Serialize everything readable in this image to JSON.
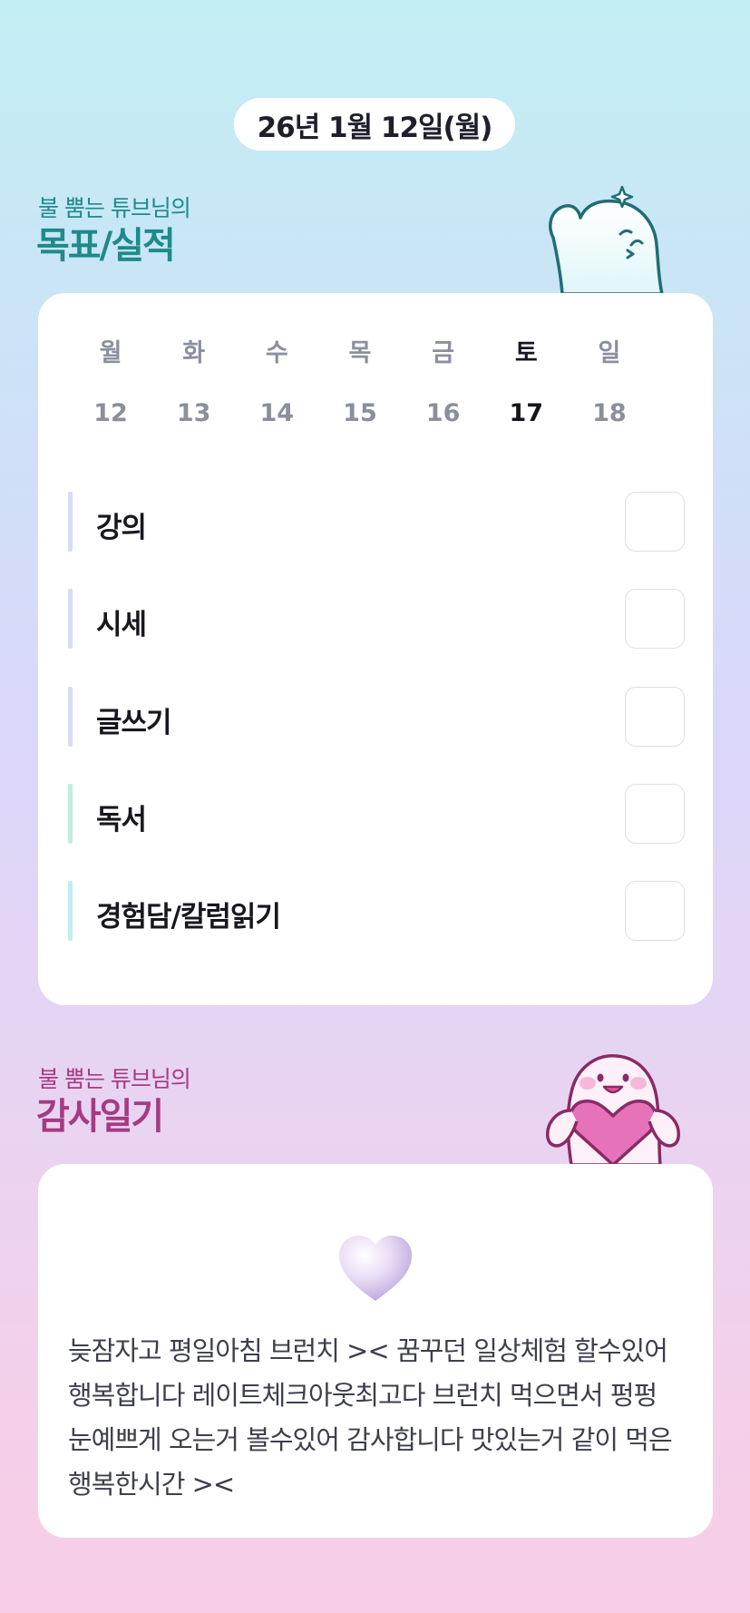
{
  "header": {
    "date": "26년 1월 12일(월)"
  },
  "goal_section": {
    "subtitle": "불 뿜는 튜브님의",
    "title": "목표/실적",
    "mascot_icon": "waving-ghost-icon"
  },
  "week": {
    "days": [
      {
        "dow": "월",
        "num": "12",
        "active": false
      },
      {
        "dow": "화",
        "num": "13",
        "active": false
      },
      {
        "dow": "수",
        "num": "14",
        "active": false
      },
      {
        "dow": "목",
        "num": "15",
        "active": false
      },
      {
        "dow": "금",
        "num": "16",
        "active": false
      },
      {
        "dow": "토",
        "num": "17",
        "active": true
      },
      {
        "dow": "일",
        "num": "18",
        "active": false
      }
    ]
  },
  "tasks": [
    {
      "label": "강의",
      "color": "#d6dcf6",
      "checked": false
    },
    {
      "label": "시세",
      "color": "#d6dcf6",
      "checked": false
    },
    {
      "label": "글쓰기",
      "color": "#d6dcf6",
      "checked": false
    },
    {
      "label": "독서",
      "color": "#bfeedd",
      "checked": false
    },
    {
      "label": "경험담/칼럼읽기",
      "color": "#c2ecee",
      "checked": false
    }
  ],
  "gratitude_section": {
    "subtitle": "불 뿜는 튜브님의",
    "title": "감사일기",
    "mascot_icon": "heart-hugging-ghost-icon",
    "heart_icon": "heart-icon",
    "entry": "늦잠자고 평일아침 브런치 >< 꿈꾸던 일상체험 할수있어 행복합니다 레이트체크아웃최고다 브런치 먹으면서 펑펑 눈예쁘게 오는거 볼수있어 감사합니다 맛있는거 같이 먹은 행복한시간 ><"
  },
  "colors": {
    "teal_title": "#1e8a8a",
    "plum_title": "#a53b82",
    "active_day": "#15151f",
    "inactive_day": "#8b8f9c"
  }
}
